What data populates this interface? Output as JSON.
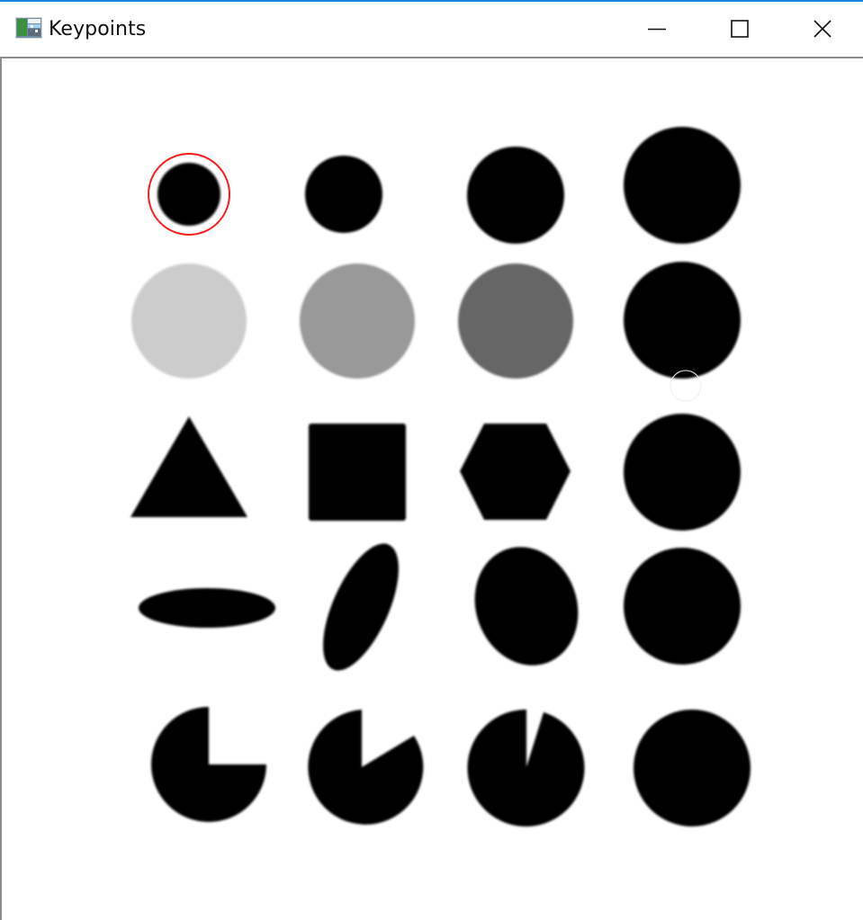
{
  "window": {
    "title": "Keypoints",
    "icon": "opencv-image-window-icon",
    "buttons": {
      "minimize": "minimize-icon",
      "maximize": "maximize-icon",
      "close": "close-icon"
    }
  },
  "colors": {
    "accent_border": "#1a86d9",
    "keypoint": "#ff1a1a",
    "shape": "#000000",
    "light_gray_circle": "#cccccc",
    "mid_gray_circle": "#999999",
    "dark_gray_circle": "#666666"
  },
  "image": {
    "rows": 5,
    "columns": 4,
    "shapes": [
      {
        "name": "small-circle",
        "fill": "#000000",
        "detected": true
      },
      {
        "name": "circle",
        "fill": "#000000",
        "detected": false
      },
      {
        "name": "circle",
        "fill": "#000000",
        "detected": false
      },
      {
        "name": "large-circle",
        "fill": "#000000",
        "detected": false
      },
      {
        "name": "light-gray-circle",
        "fill": "#cccccc",
        "detected": false
      },
      {
        "name": "mid-gray-circle",
        "fill": "#999999",
        "detected": false
      },
      {
        "name": "dark-gray-circle",
        "fill": "#666666",
        "detected": false
      },
      {
        "name": "circle",
        "fill": "#000000",
        "detected": false
      },
      {
        "name": "triangle",
        "fill": "#000000",
        "detected": false
      },
      {
        "name": "square",
        "fill": "#000000",
        "detected": false
      },
      {
        "name": "hexagon",
        "fill": "#000000",
        "detected": false
      },
      {
        "name": "circle",
        "fill": "#000000",
        "detected": false
      },
      {
        "name": "flat-ellipse",
        "fill": "#000000",
        "detected": false
      },
      {
        "name": "tilted-ellipse",
        "fill": "#000000",
        "detected": false
      },
      {
        "name": "oval",
        "fill": "#000000",
        "detected": false
      },
      {
        "name": "circle",
        "fill": "#000000",
        "detected": false
      },
      {
        "name": "pacman-quarter-cut",
        "fill": "#000000",
        "detected": false
      },
      {
        "name": "pacman-wedge-cut",
        "fill": "#000000",
        "detected": false
      },
      {
        "name": "pacman-thin-wedge-cut",
        "fill": "#000000",
        "detected": false
      },
      {
        "name": "circle",
        "fill": "#000000",
        "detected": false
      }
    ]
  }
}
